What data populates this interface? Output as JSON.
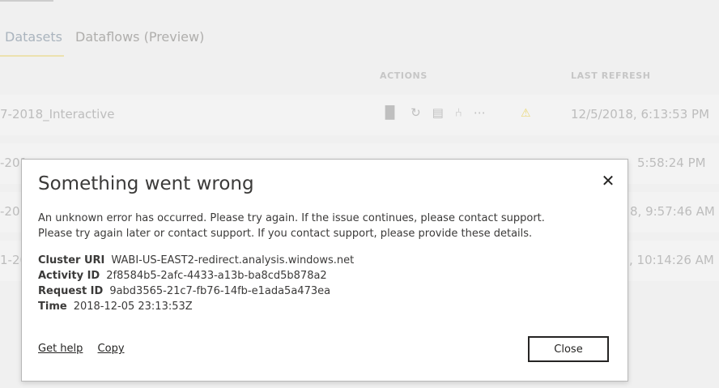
{
  "background": {
    "tabs": [
      "Datasets",
      "Dataflows (Preview)"
    ],
    "columns": {
      "actions": "ACTIONS",
      "last_refresh": "LAST REFRESH"
    },
    "rows": [
      {
        "name": "7-2018_Interactive",
        "refresh": "12/5/2018, 6:13:53 PM"
      },
      {
        "name": "-201",
        "refresh": "5:58:24 PM"
      },
      {
        "name": "-20",
        "refresh": "8, 9:57:46 AM"
      },
      {
        "name": "1-20",
        "refresh": ", 10:14:26 AM"
      }
    ],
    "action_icons": [
      "chart-icon",
      "refresh-icon",
      "schedule-icon",
      "share-icon",
      "more-icon"
    ],
    "warning_icon": "warning-icon"
  },
  "dialog": {
    "title": "Something went wrong",
    "close_icon": "close-icon",
    "message_line1": "An unknown error has occurred. Please try again. If the issue continues, please contact support.",
    "message_line2": "Please try again later or contact support. If you contact support, please provide these details.",
    "details": [
      {
        "key": "Cluster URI",
        "value": "WABI-US-EAST2-redirect.analysis.windows.net"
      },
      {
        "key": "Activity ID",
        "value": "2f8584b5-2afc-4433-a13b-ba8cd5b878a2"
      },
      {
        "key": "Request ID",
        "value": "9abd3565-21c7-fb76-14fb-e1ada5a473ea"
      },
      {
        "key": "Time",
        "value": "2018-12-05 23:13:53Z"
      }
    ],
    "links": {
      "help": "Get help",
      "copy": "Copy"
    },
    "close_button": "Close"
  }
}
